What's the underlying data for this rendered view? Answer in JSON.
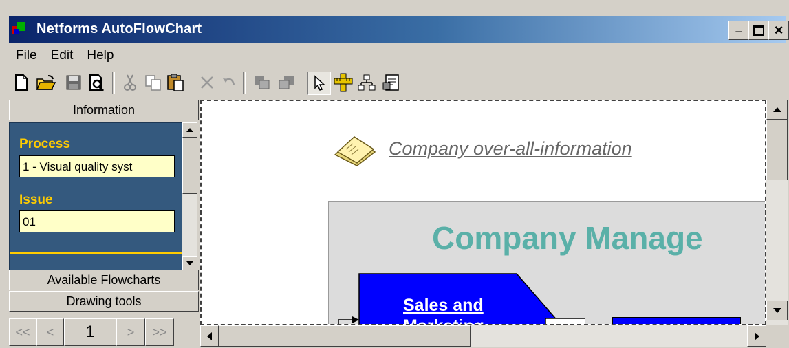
{
  "window": {
    "title": "Netforms AutoFlowChart",
    "controls": {
      "minimize": "_",
      "maximize": "□",
      "close": "×"
    }
  },
  "menu": {
    "items": [
      "File",
      "Edit",
      "Help"
    ]
  },
  "toolbar": {
    "buttons": [
      "new-icon",
      "open-icon",
      "save-icon",
      "print-preview-icon",
      "cut-icon",
      "copy-icon",
      "paste-icon",
      "delete-icon",
      "undo-icon",
      "bring-front-icon",
      "send-back-icon",
      "pointer-icon",
      "ruler-icon",
      "hierarchy-icon",
      "properties-icon"
    ]
  },
  "left_panel": {
    "information_tab": "Information",
    "fields": {
      "process_label": "Process",
      "process_value": "1 - Visual quality syst",
      "issue_label": "Issue",
      "issue_value": "01"
    },
    "available_flowcharts_tab": "Available Flowcharts",
    "drawing_tools_tab": "Drawing tools",
    "pager": {
      "first": "<<",
      "prev": "<",
      "page": "1",
      "next": ">",
      "last": ">>"
    }
  },
  "canvas": {
    "info_link": "Company over-all-information",
    "panel_title": "Company Manage",
    "shape_label_line1": "Sales and",
    "shape_label_line2": "Marketing",
    "colors": {
      "shape_fill": "#0000ff",
      "title_color": "#5ab0a8",
      "panel_bg": "#dcdcdc"
    }
  }
}
